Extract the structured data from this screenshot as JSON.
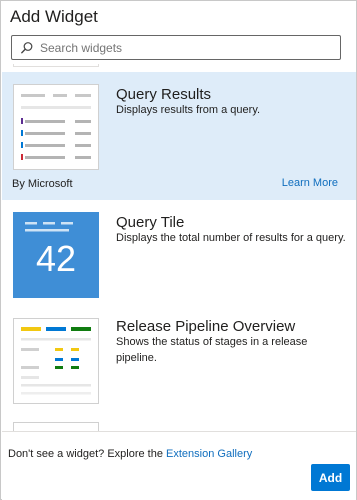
{
  "dialog": {
    "title": "Add Widget",
    "search_placeholder": "Search widgets"
  },
  "widgets": [
    {
      "name": "Query Results",
      "description": "Displays results from a query.",
      "publisher": "By Microsoft",
      "learn_more": "Learn More",
      "selected": true
    },
    {
      "name": "Query Tile",
      "description": "Displays the total number of results for a query.",
      "tile_value": "42",
      "selected": false
    },
    {
      "name": "Release Pipeline Overview",
      "description": "Shows the status of stages in a release pipeline.",
      "selected": false
    }
  ],
  "footer": {
    "text": "Don't see a widget? Explore the ",
    "link": "Extension Gallery",
    "add_label": "Add"
  },
  "colors": {
    "accent": "#0078d4",
    "selected_bg": "#deecf9",
    "tile_blue": "#3f8ed6",
    "link": "#106ebe"
  }
}
